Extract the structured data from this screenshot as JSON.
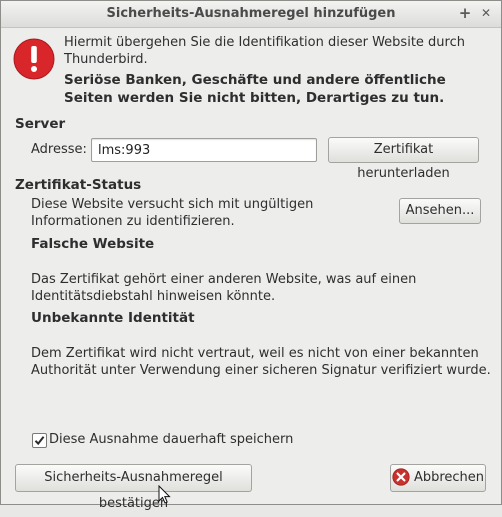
{
  "window": {
    "title": "Sicherheits-Ausnahmeregel hinzufügen",
    "controls": {
      "maximize": "+",
      "close": "✕"
    }
  },
  "message": {
    "line1": "Hiermit übergehen Sie die Identifikation dieser Website durch Thunderbird.",
    "line2": "Seriöse Banken, Geschäfte und andere öffentliche Seiten werden Sie nicht bitten, Derartiges zu tun."
  },
  "server": {
    "heading": "Server",
    "address_label": "Adresse:",
    "address_value": "lms:993",
    "download_button": "Zertifikat herunterladen"
  },
  "status": {
    "heading": "Zertifikat-Status",
    "text": "Diese Website versucht sich mit ungültigen Informationen zu identifizieren.",
    "view_button": "Ansehen...",
    "wrong_site_heading": "Falsche Website",
    "wrong_site_text": "Das Zertifikat gehört einer anderen Website, was auf einen Identitätsdiebstahl hinweisen könnte.",
    "unknown_heading": "Unbekannte Identität",
    "unknown_text": "Dem Zertifikat wird nicht vertraut, weil es nicht von einer bekannten Authorität unter Verwendung einer sicheren Signatur verifiziert wurde."
  },
  "permanent": {
    "label": "Diese Ausnahme dauerhaft speichern",
    "checked": true
  },
  "buttons": {
    "confirm": "Sicherheits-Ausnahmeregel bestätigen",
    "cancel": "Abbrechen"
  },
  "colors": {
    "alert_red": "#d8262a",
    "cancel_red": "#c8322e"
  }
}
